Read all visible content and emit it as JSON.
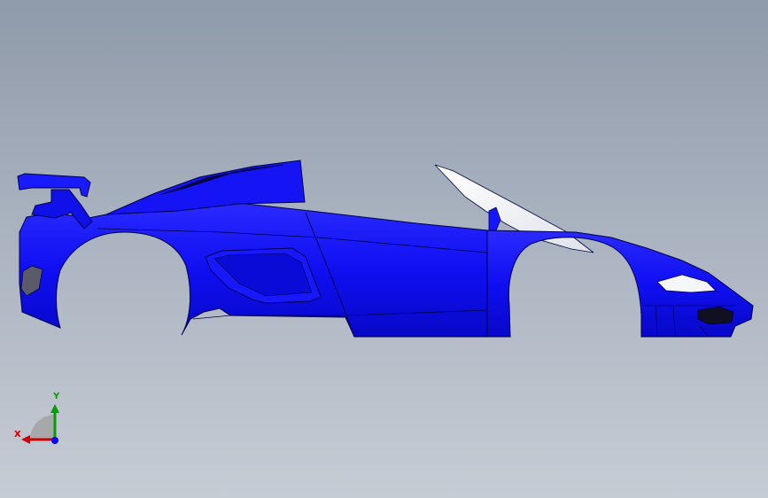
{
  "viewport": {
    "background_top": "#8f9aaa",
    "background_bottom": "#c6ccd4",
    "model": {
      "name": "car body shell",
      "body_color": "#1010f0",
      "glass_color": "#f2f4f6",
      "edge_color": "#00004a"
    },
    "triad": {
      "x_label": "X",
      "y_label": "Y",
      "x_color": "#d00000",
      "y_color": "#00a000",
      "z_color": "#0000ff"
    }
  }
}
